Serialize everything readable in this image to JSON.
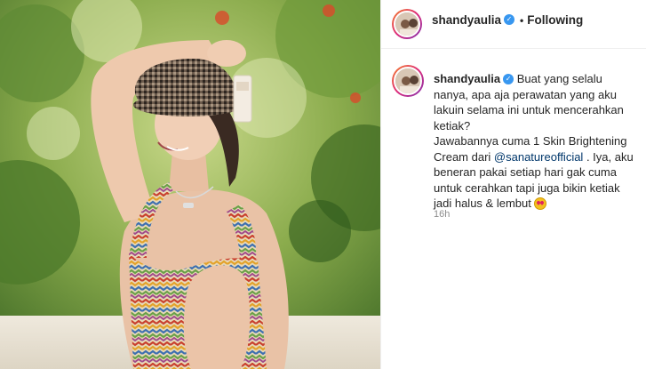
{
  "post": {
    "image_alt": "Woman in a checkered bucket hat and zigzag swimsuit holding a cream tube outdoors",
    "header": {
      "username": "shandyaulia",
      "verified_icon": "verified-badge-icon",
      "separator": "•",
      "follow_status": "Following"
    },
    "caption": {
      "username": "shandyaulia",
      "text_intro": "Buat yang selalu nanya, apa aja perawatan yang aku lakuin selama ini untuk mencerahkan ketiak?",
      "text_answer_pre": "Jawabannya cuma 1 Skin Brightening Cream dari",
      "mention": "@sanatureofficial",
      "text_answer_post": ". Iya, aku beneran pakai setiap hari gak cuma untuk cerahkan tapi juga bikin ketiak jadi halus & lembut",
      "emoji": "heart-eyes-emoji"
    },
    "timestamp": "16h"
  },
  "colors": {
    "verified": "#3897f0",
    "mention": "#00376b",
    "timestamp": "#8e8e8e",
    "divider": "#efefef"
  }
}
